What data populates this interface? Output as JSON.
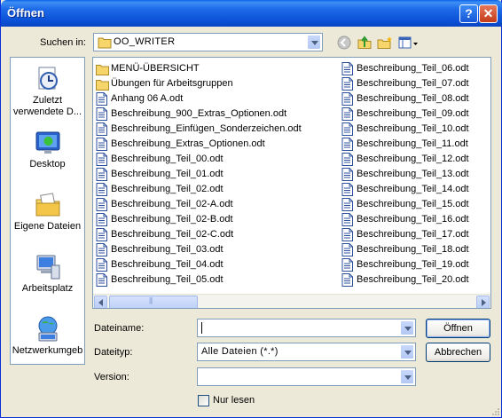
{
  "window": {
    "title": "Öffnen"
  },
  "titlebar": {
    "help_glyph": "?",
    "close_glyph": "✕"
  },
  "lookin": {
    "label": "Suchen in:",
    "value": "OO_WRITER"
  },
  "toolbar": {
    "icons": [
      "back-icon",
      "up-folder-icon",
      "new-folder-icon",
      "view-menu-icon"
    ]
  },
  "places": [
    {
      "label_line1": "Zuletzt",
      "label_line2": "verwendete D...",
      "icon": "recent-documents-icon"
    },
    {
      "label_line1": "Desktop",
      "label_line2": "",
      "icon": "desktop-icon"
    },
    {
      "label_line1": "Eigene Dateien",
      "label_line2": "",
      "icon": "my-documents-icon"
    },
    {
      "label_line1": "Arbeitsplatz",
      "label_line2": "",
      "icon": "my-computer-icon"
    },
    {
      "label_line1": "Netzwerkumgeb",
      "label_line2": "",
      "icon": "network-icon"
    }
  ],
  "files_col1": [
    {
      "name": "MENÜ-ÜBERSICHT",
      "type": "folder"
    },
    {
      "name": "Übungen für Arbeitsgruppen",
      "type": "folder"
    },
    {
      "name": "Anhang 06 A.odt",
      "type": "doc"
    },
    {
      "name": "Beschreibung_900_Extras_Optionen.odt",
      "type": "doc"
    },
    {
      "name": "Beschreibung_Einfügen_Sonderzeichen.odt",
      "type": "doc"
    },
    {
      "name": "Beschreibung_Extras_Optionen.odt",
      "type": "doc"
    },
    {
      "name": "Beschreibung_Teil_00.odt",
      "type": "doc"
    },
    {
      "name": "Beschreibung_Teil_01.odt",
      "type": "doc"
    },
    {
      "name": "Beschreibung_Teil_02.odt",
      "type": "doc"
    },
    {
      "name": "Beschreibung_Teil_02-A.odt",
      "type": "doc"
    },
    {
      "name": "Beschreibung_Teil_02-B.odt",
      "type": "doc"
    },
    {
      "name": "Beschreibung_Teil_02-C.odt",
      "type": "doc"
    },
    {
      "name": "Beschreibung_Teil_03.odt",
      "type": "doc"
    },
    {
      "name": "Beschreibung_Teil_04.odt",
      "type": "doc"
    },
    {
      "name": "Beschreibung_Teil_05.odt",
      "type": "doc"
    }
  ],
  "files_col2": [
    {
      "name": "Beschreibung_Teil_06.odt",
      "type": "doc"
    },
    {
      "name": "Beschreibung_Teil_07.odt",
      "type": "doc"
    },
    {
      "name": "Beschreibung_Teil_08.odt",
      "type": "doc"
    },
    {
      "name": "Beschreibung_Teil_09.odt",
      "type": "doc"
    },
    {
      "name": "Beschreibung_Teil_10.odt",
      "type": "doc"
    },
    {
      "name": "Beschreibung_Teil_11.odt",
      "type": "doc"
    },
    {
      "name": "Beschreibung_Teil_12.odt",
      "type": "doc"
    },
    {
      "name": "Beschreibung_Teil_13.odt",
      "type": "doc"
    },
    {
      "name": "Beschreibung_Teil_14.odt",
      "type": "doc"
    },
    {
      "name": "Beschreibung_Teil_15.odt",
      "type": "doc"
    },
    {
      "name": "Beschreibung_Teil_16.odt",
      "type": "doc"
    },
    {
      "name": "Beschreibung_Teil_17.odt",
      "type": "doc"
    },
    {
      "name": "Beschreibung_Teil_18.odt",
      "type": "doc"
    },
    {
      "name": "Beschreibung_Teil_19.odt",
      "type": "doc"
    },
    {
      "name": "Beschreibung_Teil_20.odt",
      "type": "doc"
    }
  ],
  "filename": {
    "label": "Dateiname:",
    "value": ""
  },
  "filetype": {
    "label": "Dateityp:",
    "value": "Alle Dateien (*.*)"
  },
  "version": {
    "label": "Version:",
    "value": ""
  },
  "readonly": {
    "label": "Nur lesen",
    "checked": false
  },
  "buttons": {
    "open": "Öffnen",
    "cancel": "Abbrechen"
  },
  "colors": {
    "titlebar": "#0a4fd6",
    "dialog_bg": "#ece9d8",
    "field_border": "#7f9db9",
    "folder": "#f0c84b"
  }
}
